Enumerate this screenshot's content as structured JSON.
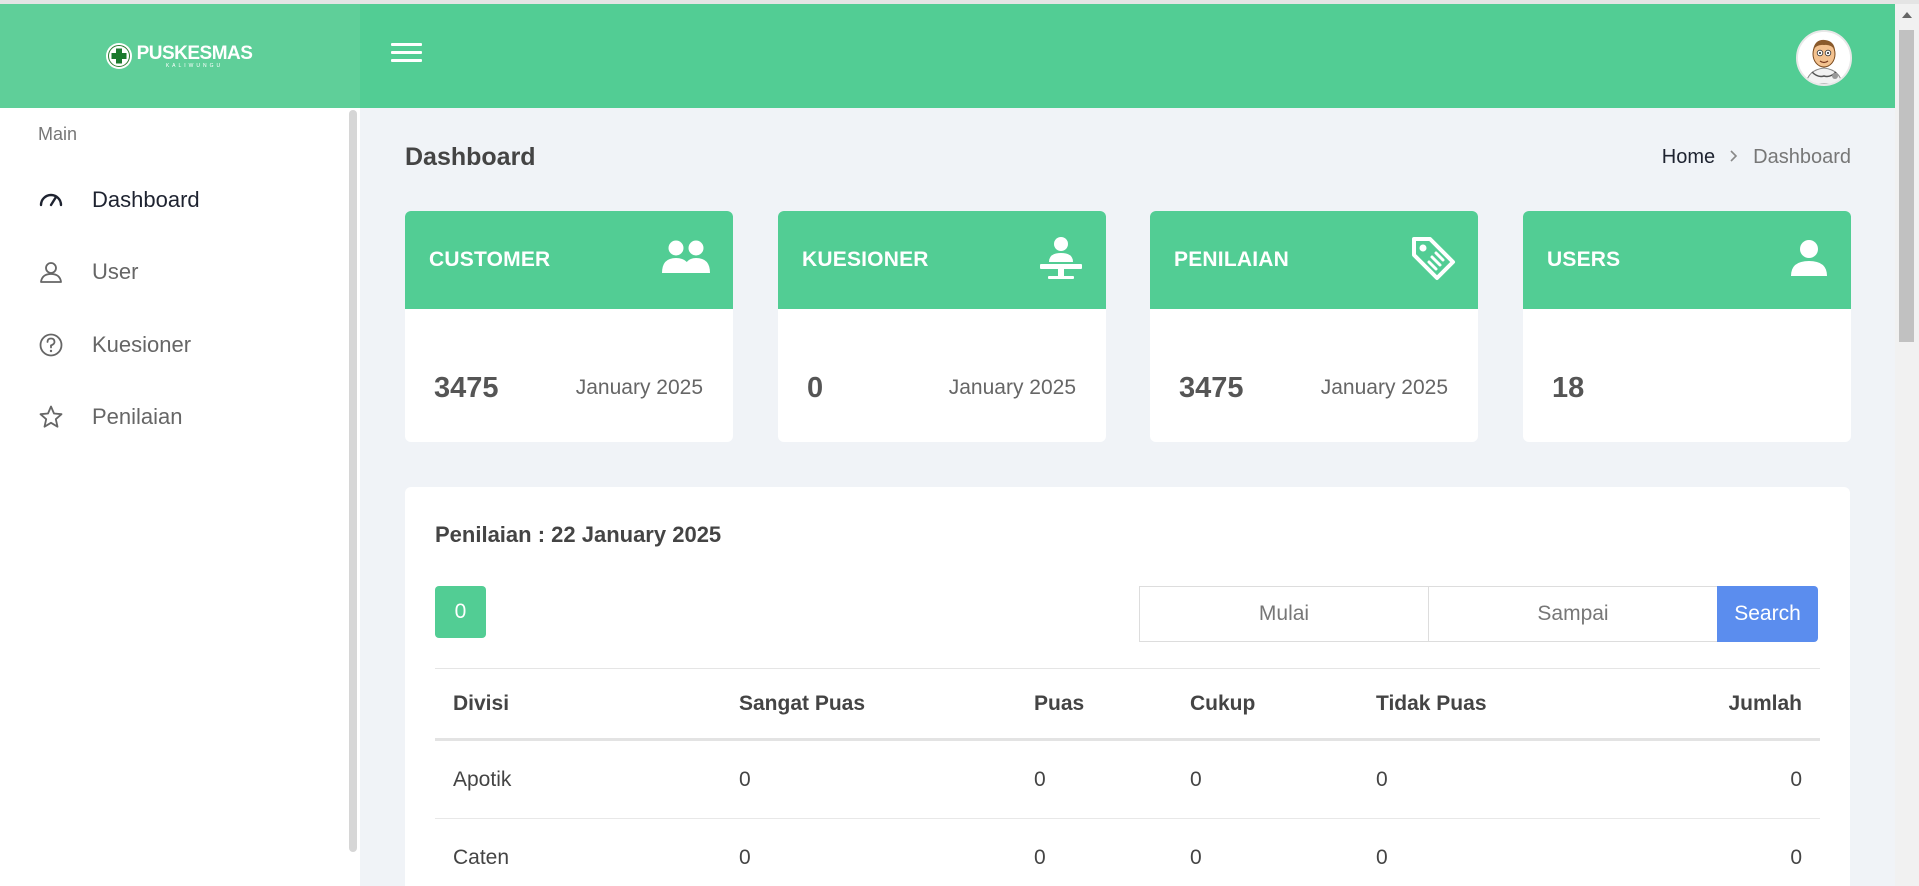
{
  "app": {
    "logo_title": "PUSKESMAS",
    "logo_subtitle": "KALIWUNGU"
  },
  "colors": {
    "primary": "#52cd94",
    "primary_light": "#5fcf99",
    "search_button": "#5b8dee",
    "background": "#f0f3f7"
  },
  "sidebar": {
    "heading": "Main",
    "items": [
      {
        "label": "Dashboard",
        "icon": "speedometer-icon",
        "active": true
      },
      {
        "label": "User",
        "icon": "user-icon",
        "active": false
      },
      {
        "label": "Kuesioner",
        "icon": "question-circle-icon",
        "active": false
      },
      {
        "label": "Penilaian",
        "icon": "star-icon",
        "active": false
      }
    ]
  },
  "page": {
    "title": "Dashboard",
    "breadcrumb": {
      "home": "Home",
      "separator": ">",
      "current": "Dashboard"
    }
  },
  "cards": [
    {
      "title": "CUSTOMER",
      "icon": "users-icon",
      "value": "3475",
      "date": "January 2025"
    },
    {
      "title": "KUESIONER",
      "icon": "person-desk-icon",
      "value": "0",
      "date": "January 2025"
    },
    {
      "title": "PENILAIAN",
      "icon": "tag-icon",
      "value": "3475",
      "date": "January 2025"
    },
    {
      "title": "USERS",
      "icon": "user-solid-icon",
      "value": "18",
      "date": ""
    }
  ],
  "panel": {
    "title": "Penilaian : 22 January 2025",
    "count": "0",
    "filter": {
      "start_placeholder": "Mulai",
      "end_placeholder": "Sampai",
      "search_label": "Search"
    }
  },
  "table": {
    "headers": [
      "Divisi",
      "Sangat Puas",
      "Puas",
      "Cukup",
      "Tidak Puas",
      "Jumlah"
    ],
    "rows": [
      [
        "Apotik",
        "0",
        "0",
        "0",
        "0",
        "0"
      ],
      [
        "Caten",
        "0",
        "0",
        "0",
        "0",
        "0"
      ]
    ]
  }
}
